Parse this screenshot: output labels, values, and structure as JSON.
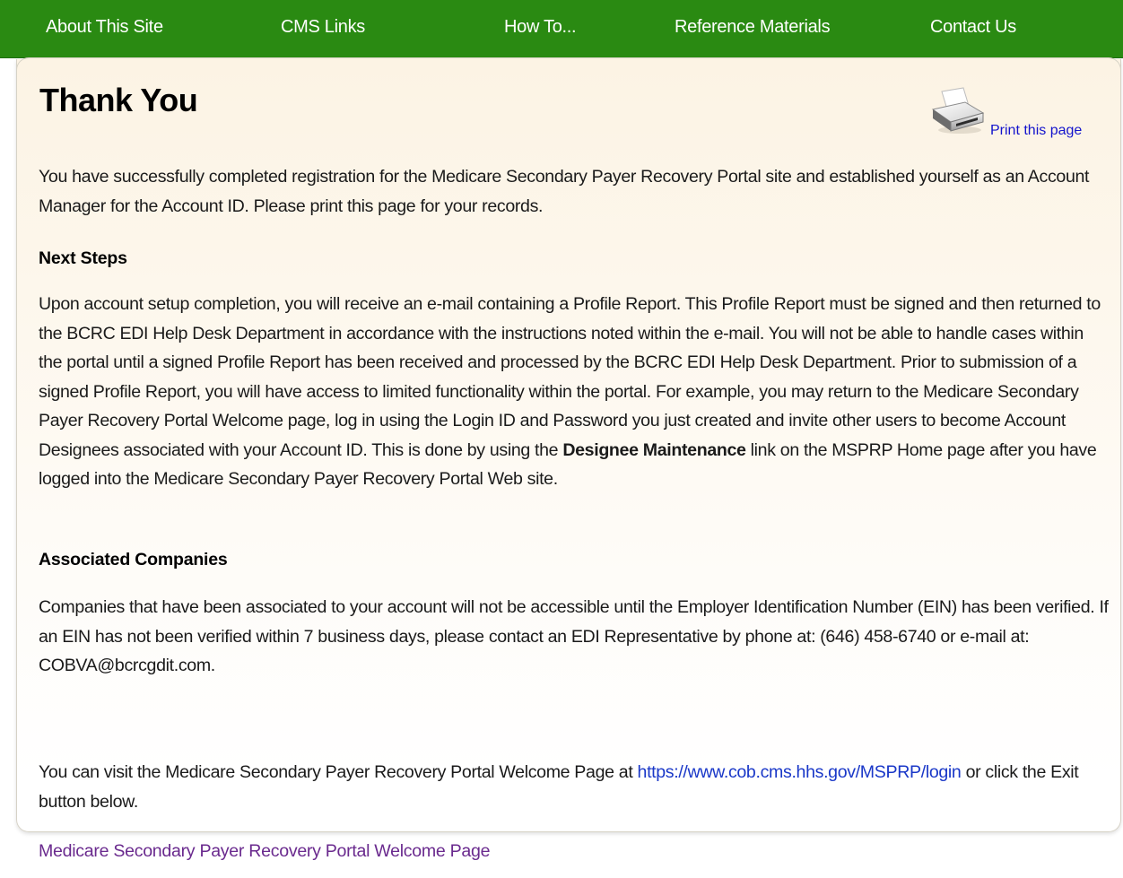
{
  "nav": {
    "about": "About This Site",
    "cms_links": "CMS Links",
    "how_to": "How To...",
    "reference": "Reference Materials",
    "contact": "Contact Us"
  },
  "page": {
    "title": "Thank You",
    "print_label": "Print this page",
    "intro": "You have successfully completed registration for the Medicare Secondary Payer Recovery Portal site and established yourself as an Account Manager for the Account ID. Please print this page for your records.",
    "next_steps_heading": "Next Steps",
    "next_steps_before": "Upon account setup completion, you will receive an e-mail containing a Profile Report. This Profile Report must be signed and then returned to the BCRC EDI Help Desk Department in accordance with the instructions noted within the e-mail. You will not be able to handle cases within the portal until a signed Profile Report has been received and processed by the BCRC EDI Help Desk Department. Prior to submission of a signed Profile Report, you will have access to limited functionality within the portal. For example, you may return to the Medicare Secondary Payer Recovery Portal Welcome page, log in using the Login ID and Password you just created and invite other users to become Account Designees associated with your Account ID. This is done by using the ",
    "next_steps_bold": "Designee Maintenance",
    "next_steps_after": " link on the MSPRP Home page after you have logged into the Medicare Secondary Payer Recovery Portal Web site.",
    "associated_heading": "Associated Companies",
    "associated_text": "Companies that have been associated to your account will not be accessible until the Employer Identification Number (EIN) has been verified. If an EIN has not been verified within 7 business days, please contact an EDI Representative by phone at: (646) 458-6740 or e-mail at: COBVA@bcrcgdit.com.",
    "visit_before": "You can visit the Medicare Secondary Payer Recovery Portal Welcome Page at ",
    "visit_url": "https://www.cob.cms.hhs.gov/MSPRP/login",
    "visit_after": " or click the Exit button below.",
    "welcome_link": "Medicare Secondary Payer Recovery Portal Welcome Page"
  },
  "colors": {
    "nav_bg": "#2a8a12",
    "panel_bg": "#fcf3e4",
    "link": "#1a38c8",
    "visited_link": "#6a2a8e"
  }
}
